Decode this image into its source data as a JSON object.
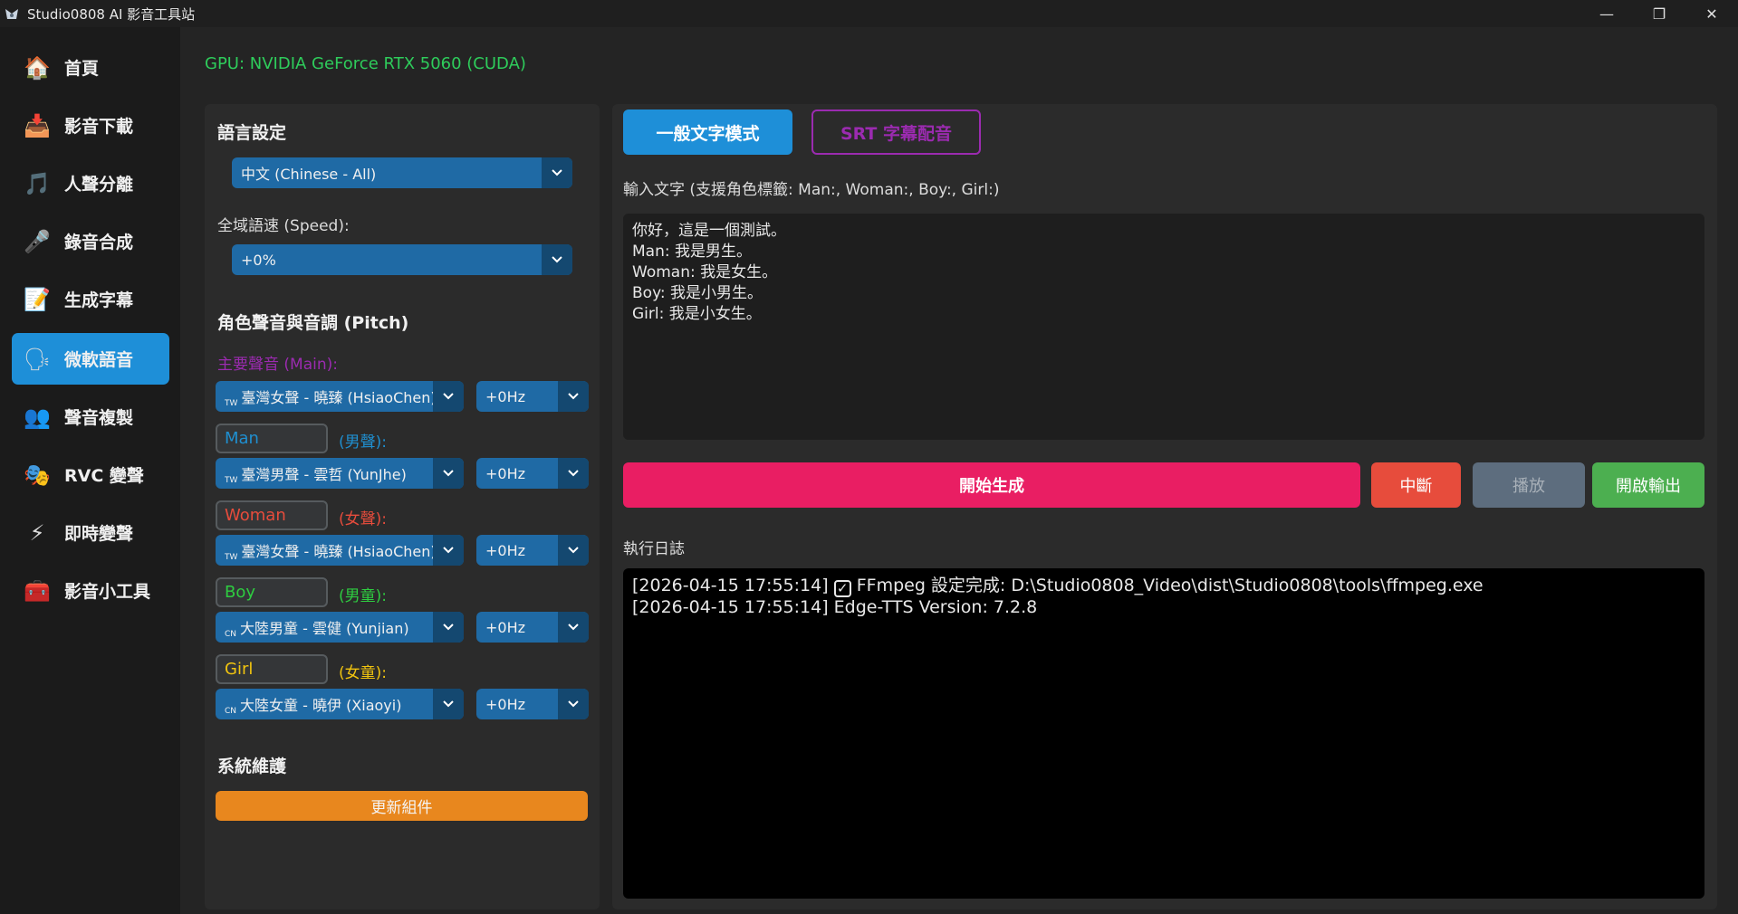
{
  "window": {
    "title": "Studio0808 AI 影音工具站",
    "minimize": "—",
    "restore": "❐",
    "close": "✕"
  },
  "sidebar": {
    "items": [
      {
        "label": "首頁",
        "icon": "home-icon",
        "glyph": "🏠"
      },
      {
        "label": "影音下載",
        "icon": "download-icon",
        "glyph": "📥"
      },
      {
        "label": "人聲分離",
        "icon": "music-note-icon",
        "glyph": "🎵"
      },
      {
        "label": "錄音合成",
        "icon": "microphone-icon",
        "glyph": "🎤"
      },
      {
        "label": "生成字幕",
        "icon": "memo-icon",
        "glyph": "📝"
      },
      {
        "label": "微軟語音",
        "icon": "speaking-head-icon",
        "glyph": "🗣"
      },
      {
        "label": "聲音複製",
        "icon": "user-copy-icon",
        "glyph": "👥"
      },
      {
        "label": "RVC 變聲",
        "icon": "masks-icon",
        "glyph": "🎭"
      },
      {
        "label": "即時變聲",
        "icon": "lightning-icon",
        "glyph": "⚡"
      },
      {
        "label": "影音小工具",
        "icon": "toolbox-icon",
        "glyph": "🧰"
      }
    ],
    "active_index": 5
  },
  "gpu_status": "GPU: NVIDIA GeForce RTX 5060 (CUDA)",
  "left": {
    "language_title": "語言設定",
    "language_value": "中文 (Chinese - All)",
    "speed_label": "全域語速 (Speed):",
    "speed_value": "+0%",
    "roles_title": "角色聲音與音調 (Pitch)",
    "main_label": "主要聲音 (Main):",
    "main_voice": "臺灣女聲 - 曉臻 (HsiaoChen)",
    "main_voice_flag": "TW",
    "main_pitch": "+0Hz",
    "roles": [
      {
        "name": "Man",
        "tag": "(男聲):",
        "color": "#1f8fd0",
        "voice": "臺灣男聲 - 雲哲 (YunJhe)",
        "flag": "TW",
        "pitch": "+0Hz"
      },
      {
        "name": "Woman",
        "tag": "(女聲):",
        "color": "#e74c3c",
        "voice": "臺灣女聲 - 曉臻 (HsiaoChen)",
        "flag": "TW",
        "pitch": "+0Hz"
      },
      {
        "name": "Boy",
        "tag": "(男童):",
        "color": "#2ecc40",
        "voice": "大陸男童 - 雲健 (Yunjian)",
        "flag": "CN",
        "pitch": "+0Hz"
      },
      {
        "name": "Girl",
        "tag": "(女童):",
        "color": "#f1c40f",
        "voice": "大陸女童 - 曉伊 (Xiaoyi)",
        "flag": "CN",
        "pitch": "+0Hz"
      }
    ],
    "maintenance_title": "系統維護",
    "update_button": "更新組件",
    "main_label_color": "#9b2bb0"
  },
  "right": {
    "mode_general": "一般文字模式",
    "mode_srt": "SRT 字幕配音",
    "text_hint": "輸入文字 (支援角色標籤: Man:, Woman:, Boy:, Girl:)",
    "text_lines": [
      "你好，這是一個測試。",
      "Man: 我是男生。",
      "Woman: 我是女生。",
      "Boy: 我是小男生。",
      "Girl: 我是小女生。"
    ],
    "buttons": {
      "start": "開始生成",
      "stop": "中斷",
      "play": "播放",
      "open": "開啟輸出"
    },
    "log_label": "執行日誌",
    "log_lines": [
      {
        "prefix": "[2026-04-15 17:55:14]",
        "icon": "checkbox-icon",
        "text": "FFmpeg 設定完成: D:\\Studio0808_Video\\dist\\Studio0808\\tools\\ffmpeg.exe"
      },
      {
        "prefix": "[2026-04-15 17:55:14]",
        "icon": "",
        "text": "Edge-TTS Version: 7.2.8"
      }
    ]
  },
  "colors": {
    "accent": "#1e8fd8",
    "start": "#e91e63",
    "stop": "#e74c3c",
    "open": "#4caf50",
    "update": "#e8871e",
    "gpu": "#2ecc5b"
  }
}
